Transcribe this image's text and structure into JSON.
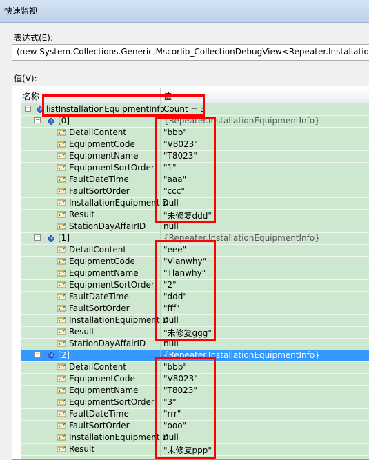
{
  "window": {
    "title": "快速监视"
  },
  "expression": {
    "label": "表达式(E):",
    "value": "(new System.Collections.Generic.Mscorlib_CollectionDebugView<Repeater.InstallationEqu"
  },
  "values": {
    "label": "值(V):"
  },
  "columns": {
    "name": "名称",
    "value": "值"
  },
  "root": {
    "name": "listInstallationEquipmentInfo",
    "value": "Count = 3"
  },
  "groups": [
    {
      "name": "[0]",
      "value": "{Repeater.InstallationEquipmentInfo}",
      "props": [
        {
          "name": "DetailContent",
          "value": "\"bbb\""
        },
        {
          "name": "EquipmentCode",
          "value": "\"V8023\""
        },
        {
          "name": "EquipmentName",
          "value": "\"T8023\""
        },
        {
          "name": "EquipmentSortOrder",
          "value": "\"1\""
        },
        {
          "name": "FaultDateTime",
          "value": "\"aaa\""
        },
        {
          "name": "FaultSortOrder",
          "value": "\"ccc\""
        },
        {
          "name": "InstallationEquipmentID",
          "value": "null"
        },
        {
          "name": "Result",
          "value": "\"未修复ddd\""
        },
        {
          "name": "StationDayAffairID",
          "value": "null"
        }
      ]
    },
    {
      "name": "[1]",
      "value": "{Repeater.InstallationEquipmentInfo}",
      "props": [
        {
          "name": "DetailContent",
          "value": "\"eee\""
        },
        {
          "name": "EquipmentCode",
          "value": "\"Vlanwhy\""
        },
        {
          "name": "EquipmentName",
          "value": "\"Tlanwhy\""
        },
        {
          "name": "EquipmentSortOrder",
          "value": "\"2\""
        },
        {
          "name": "FaultDateTime",
          "value": "\"ddd\""
        },
        {
          "name": "FaultSortOrder",
          "value": "\"fff\""
        },
        {
          "name": "InstallationEquipmentID",
          "value": "null"
        },
        {
          "name": "Result",
          "value": "\"未修复ggg\""
        },
        {
          "name": "StationDayAffairID",
          "value": "null"
        }
      ]
    },
    {
      "name": "[2]",
      "value": "{Repeater.InstallationEquipmentInfo}",
      "props": [
        {
          "name": "DetailContent",
          "value": "\"bbb\""
        },
        {
          "name": "EquipmentCode",
          "value": "\"V8023\""
        },
        {
          "name": "EquipmentName",
          "value": "\"T8023\""
        },
        {
          "name": "EquipmentSortOrder",
          "value": "\"3\""
        },
        {
          "name": "FaultDateTime",
          "value": "\"rrr\""
        },
        {
          "name": "FaultSortOrder",
          "value": "\"ooo\""
        },
        {
          "name": "InstallationEquipmentID",
          "value": "null"
        },
        {
          "name": "Result",
          "value": "\"未修复ppp\""
        }
      ]
    }
  ]
}
